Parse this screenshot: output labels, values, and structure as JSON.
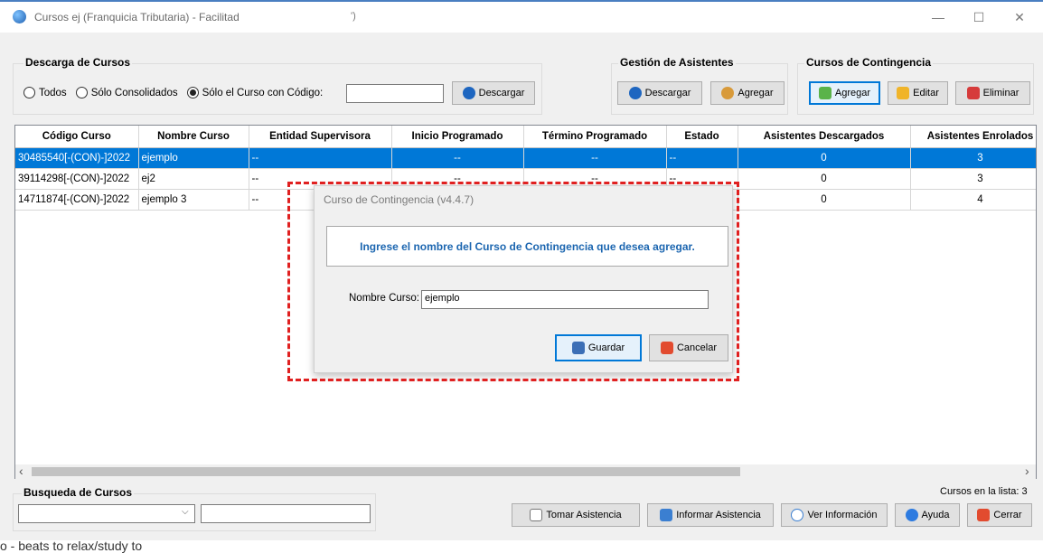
{
  "window": {
    "title": "Cursos ej (Franquicia Tributaria) - Facilitad",
    "title_fragment": "')",
    "minimize": "—",
    "maximize": "☐",
    "close": "✕"
  },
  "download_group": {
    "title": "Descarga de Cursos",
    "radio_all": "Todos",
    "radio_consolidated": "Sólo Consolidados",
    "radio_code": "Sólo el Curso con Código:",
    "selected": "radio_code",
    "code_value": "",
    "download_button": "Descargar"
  },
  "attendees_group": {
    "title": "Gestión de Asistentes",
    "download_button": "Descargar",
    "add_button": "Agregar"
  },
  "contingency_group": {
    "title": "Cursos de Contingencia",
    "add_button": "Agregar",
    "edit_button": "Editar",
    "delete_button": "Eliminar"
  },
  "table": {
    "columns": [
      "Código Curso",
      "Nombre Curso",
      "Entidad Supervisora",
      "Inicio Programado",
      "Término Programado",
      "Estado",
      "Asistentes Descargados",
      "Asistentes Enrolados"
    ],
    "rows": [
      [
        "30485540[-(CON)-]2022",
        "ejemplo",
        "--",
        "--",
        "--",
        "--",
        "0",
        "3"
      ],
      [
        "39114298[-(CON)-]2022",
        "ej2",
        "--",
        "--",
        "--",
        "--",
        "0",
        "3"
      ],
      [
        "14711874[-(CON)-]2022",
        "ejemplo 3",
        "--",
        "--",
        "--",
        "--",
        "0",
        "4"
      ]
    ],
    "selected_row": 0,
    "scroll_left": "‹",
    "scroll_right": "›"
  },
  "dialog": {
    "title": "Curso de Contingencia (v4.4.7)",
    "message": "Ingrese el nombre del Curso de Contingencia que desea agregar.",
    "field_label": "Nombre Curso:",
    "field_value": "ejemplo",
    "save_button": "Guardar",
    "cancel_button": "Cancelar"
  },
  "search_group": {
    "title": "Busqueda de Cursos",
    "combo_value": "",
    "text_value": ""
  },
  "footer": {
    "count_label": "Cursos en la lista: 3",
    "take_attendance": "Tomar Asistencia",
    "report_attendance": "Informar Asistencia",
    "view_info": "Ver Información",
    "help": "Ayuda",
    "close": "Cerrar"
  },
  "background_text": "o - beats to relax/study to",
  "colors": {
    "accent": "#0078d7",
    "selection": "#0078d7",
    "dialog_message": "#1c66b0",
    "highlight_dashed": "#e02020"
  }
}
